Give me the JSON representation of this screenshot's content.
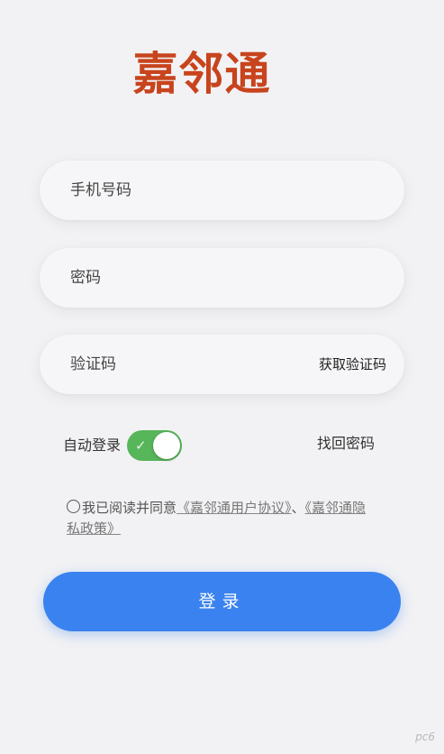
{
  "app": {
    "logo_text": "嘉邻通"
  },
  "form": {
    "phone_placeholder": "手机号码",
    "password_placeholder": "密码",
    "code_placeholder": "验证码",
    "get_code_label": "获取验证码"
  },
  "options": {
    "auto_login_label": "自动登录",
    "auto_login_enabled": true,
    "forgot_password_label": "找回密码"
  },
  "agreement": {
    "prefix": "我已阅读并同意",
    "user_agreement_link": "《嘉邻通用户协议》",
    "separator": "、",
    "privacy_link": "《嘉邻通隐私政策》",
    "checked": false
  },
  "login_button_label": "登录",
  "watermark": "pc6",
  "colors": {
    "brand": "#c8441d",
    "primary": "#3a82ef",
    "toggle_on": "#57b55a"
  }
}
